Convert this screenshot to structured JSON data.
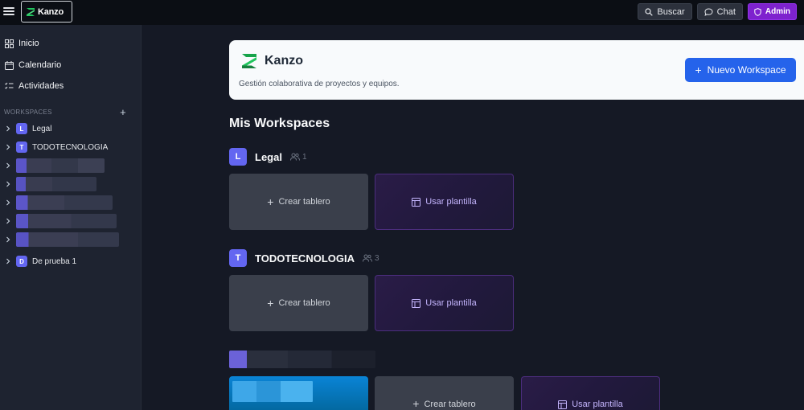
{
  "app": {
    "name": "Kanzo"
  },
  "topbar": {
    "search_label": "Buscar",
    "chat_label": "Chat",
    "admin_label": "Admin"
  },
  "sidebar": {
    "nav": [
      {
        "label": "Inicio",
        "icon": "grid-icon"
      },
      {
        "label": "Calendario",
        "icon": "calendar-icon"
      },
      {
        "label": "Actividades",
        "icon": "checklist-icon"
      }
    ],
    "workspaces_header": "WORKSPACES",
    "workspaces": [
      {
        "initial": "L",
        "label": "Legal"
      },
      {
        "initial": "T",
        "label": "TODOTECNOLOGIA"
      },
      {
        "initial": "D",
        "label": "De prueba 1"
      }
    ]
  },
  "hero": {
    "title": "Kanzo",
    "subtitle": "Gestión colaborativa de proyectos y equipos.",
    "new_workspace_label": "Nuevo Workspace"
  },
  "main": {
    "section_title": "Mis Workspaces",
    "workspaces": [
      {
        "initial": "L",
        "name": "Legal",
        "members": "1",
        "create_label": "Crear tablero",
        "template_label": "Usar plantilla"
      },
      {
        "initial": "T",
        "name": "TODOTECNOLOGIA",
        "members": "3",
        "create_label": "Crear tablero",
        "template_label": "Usar plantilla"
      },
      {
        "create_label": "Crear tablero",
        "template_label": "Usar plantilla"
      }
    ]
  },
  "colors": {
    "accent": "#2563eb",
    "admin": "#7e22ce",
    "avatar": "#6366f1"
  }
}
